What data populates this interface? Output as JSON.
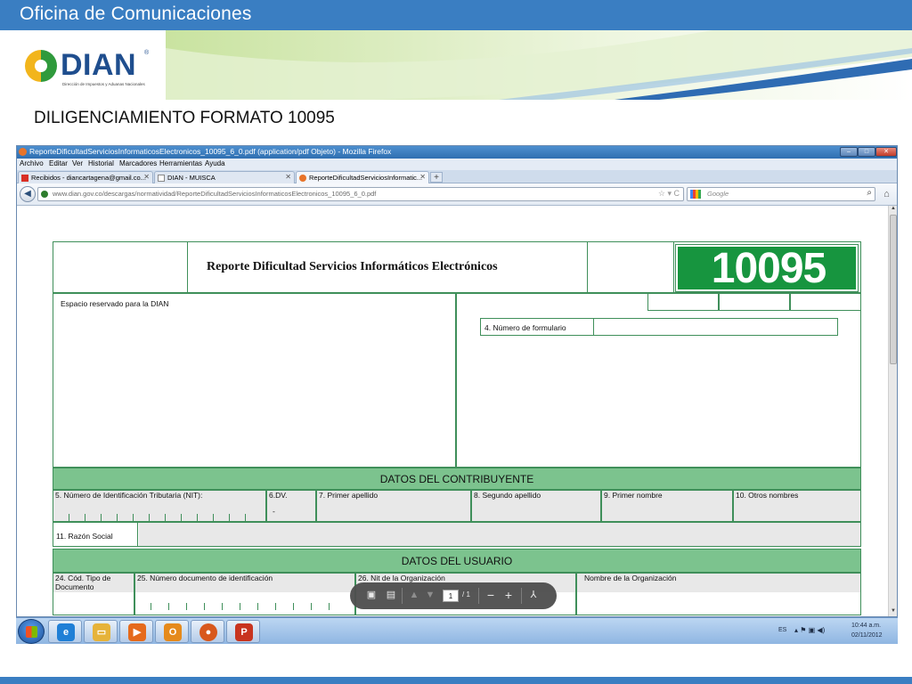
{
  "slide": {
    "header_title": "Oficina de Comunicaciones",
    "logo_text": "DIAN",
    "logo_registered": "®",
    "logo_subtitle": "Dirección de Impuestos y Aduanas Nacionales",
    "subtitle": "DILIGENCIAMIENTO FORMATO 10095"
  },
  "browser": {
    "window_title": "ReporteDificultadServiciosInformaticosElectronicos_10095_6_0.pdf (application/pdf Objeto) - Mozilla Firefox",
    "window_buttons": {
      "minimize": "–",
      "maximize": "□",
      "close": "✕"
    },
    "menu": [
      "Archivo",
      "Editar",
      "Ver",
      "Historial",
      "Marcadores",
      "Herramientas",
      "Ayuda"
    ],
    "tabs": [
      {
        "label": "Recibidos - diancartagena@gmail.co...",
        "icon": "gmail-icon",
        "active": false
      },
      {
        "label": "DIAN - MUISCA",
        "icon": "page-icon",
        "active": false
      },
      {
        "label": "ReporteDificultadServiciosInformatic...",
        "icon": "firefox-pdf-icon",
        "active": true
      }
    ],
    "tab_close": "✕",
    "new_tab": "+",
    "url": "www.dian.gov.co/descargas/normatividad/ReporteDificultadServiciosInformaticosElectronicos_10095_6_0.pdf",
    "search_placeholder": "Google",
    "icons": {
      "back": "back-arrow-icon",
      "home": "home-icon",
      "search": "magnifier-icon",
      "bookmark": "star-icon"
    }
  },
  "form": {
    "title": "Reporte Dificultad Servicios Informáticos Electrónicos",
    "number": "10095",
    "reserved_label": "Espacio reservado para la DIAN",
    "form_number_label": "4. Número de formulario",
    "section_contribuyente": "DATOS DEL CONTRIBUYENTE",
    "contribuyente_fields": [
      "5. Número de Identificación Tributaria (NIT):",
      "6.DV.",
      "7. Primer apellido",
      "8. Segundo apellido",
      "9. Primer nombre",
      "10. Otros nombres"
    ],
    "dv_dash": "-",
    "razon_social": "11. Razón Social",
    "section_usuario": "DATOS DEL USUARIO",
    "usuario_fields": [
      "24. Cód. Tipo de Documento",
      "25. Número documento de identificación",
      "26. Nit de la Organización",
      "Nombre de la Organización"
    ]
  },
  "pdf_toolbar": {
    "current_page": "1",
    "total_pages": "/ 1",
    "icons": [
      "save-icon",
      "print-icon",
      "page-up-icon",
      "page-down-icon",
      "zoom-out-icon",
      "zoom-in-icon",
      "adobe-icon"
    ]
  },
  "taskbar": {
    "language": "ES",
    "time": "10:44 a.m.",
    "date": "02/11/2012",
    "apps": [
      "internet-explorer-icon",
      "file-explorer-icon",
      "media-player-icon",
      "outlook-icon",
      "firefox-icon",
      "powerpoint-icon"
    ]
  },
  "colors": {
    "header_blue": "#3a7ec2",
    "form_green": "#17953f",
    "section_green": "#7cc38e",
    "dian_blue": "#1f4e8e"
  }
}
